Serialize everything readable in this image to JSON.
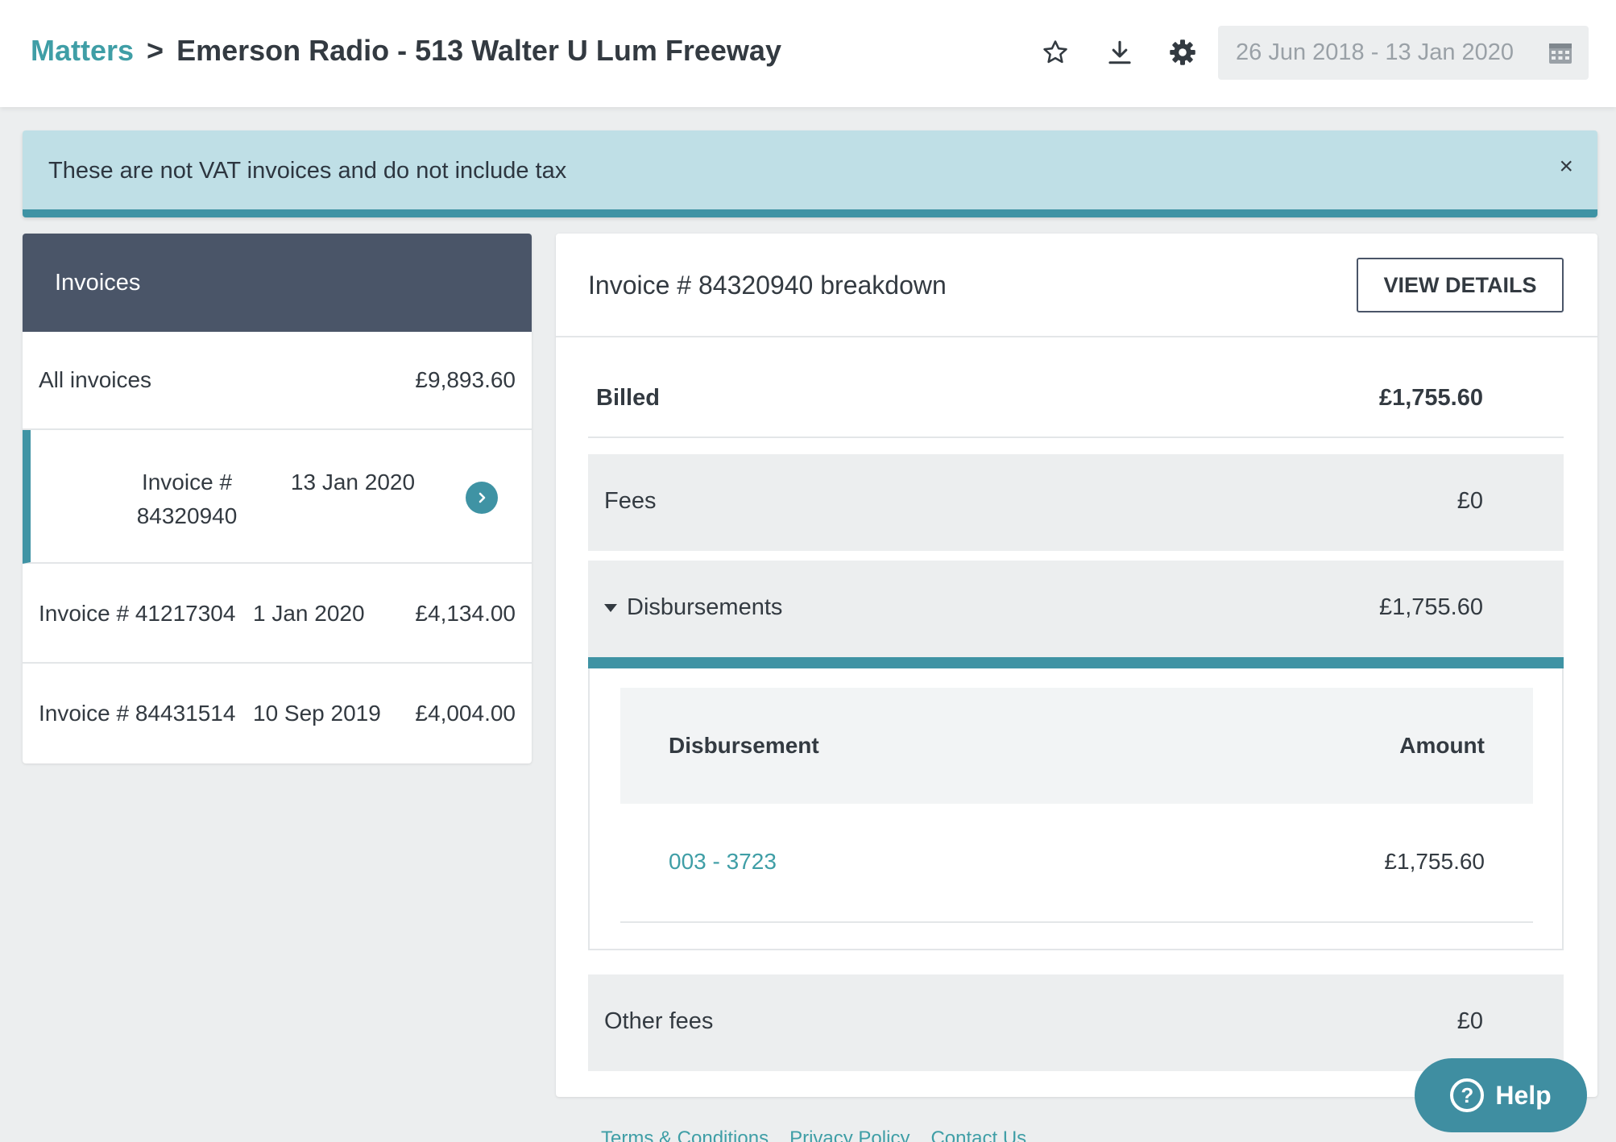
{
  "header": {
    "breadcrumb_root": "Matters",
    "breadcrumb_sep": ">",
    "breadcrumb_current": "Emerson Radio - 513 Walter U Lum Freeway",
    "date_range": "26 Jun 2018 - 13 Jan 2020",
    "icons": [
      "star-icon",
      "download-icon",
      "gear-icon",
      "calendar-icon"
    ]
  },
  "alert": {
    "text": "These are not VAT invoices and do not include tax",
    "close": "×"
  },
  "invoices": {
    "title": "Invoices",
    "all": {
      "label": "All invoices",
      "amount": "£9,893.60"
    },
    "selected": {
      "number": "Invoice # 84320940",
      "date": "13 Jan 2020"
    },
    "rows": [
      {
        "number": "Invoice # 41217304",
        "date": "1 Jan 2020",
        "amount": "£4,134.00"
      },
      {
        "number": "Invoice # 84431514",
        "date": "10 Sep 2019",
        "amount": "£4,004.00"
      }
    ]
  },
  "breakdown": {
    "title": "Invoice # 84320940 breakdown",
    "view_details": "VIEW DETAILS",
    "billed": {
      "label": "Billed",
      "value": "£1,755.60"
    },
    "fees": {
      "label": "Fees",
      "value": "£0"
    },
    "disbursements": {
      "label": "Disbursements",
      "value": "£1,755.60",
      "col_disbursement": "Disbursement",
      "col_amount": "Amount",
      "items": [
        {
          "ref": "003 - 3723",
          "amount": "£1,755.60"
        }
      ]
    },
    "other_fees": {
      "label": "Other fees",
      "value": "£0"
    }
  },
  "help": {
    "label": "Help",
    "glyph": "?"
  },
  "footer": {
    "links": [
      "Terms & Conditions",
      "Privacy Policy",
      "Contact Us"
    ]
  },
  "colors": {
    "accent": "#3f9ea6",
    "accent_dark": "#3f93a4",
    "panel_header": "#4a5568",
    "alert_bg": "#bfdfe6",
    "page_bg": "#eceeef"
  }
}
